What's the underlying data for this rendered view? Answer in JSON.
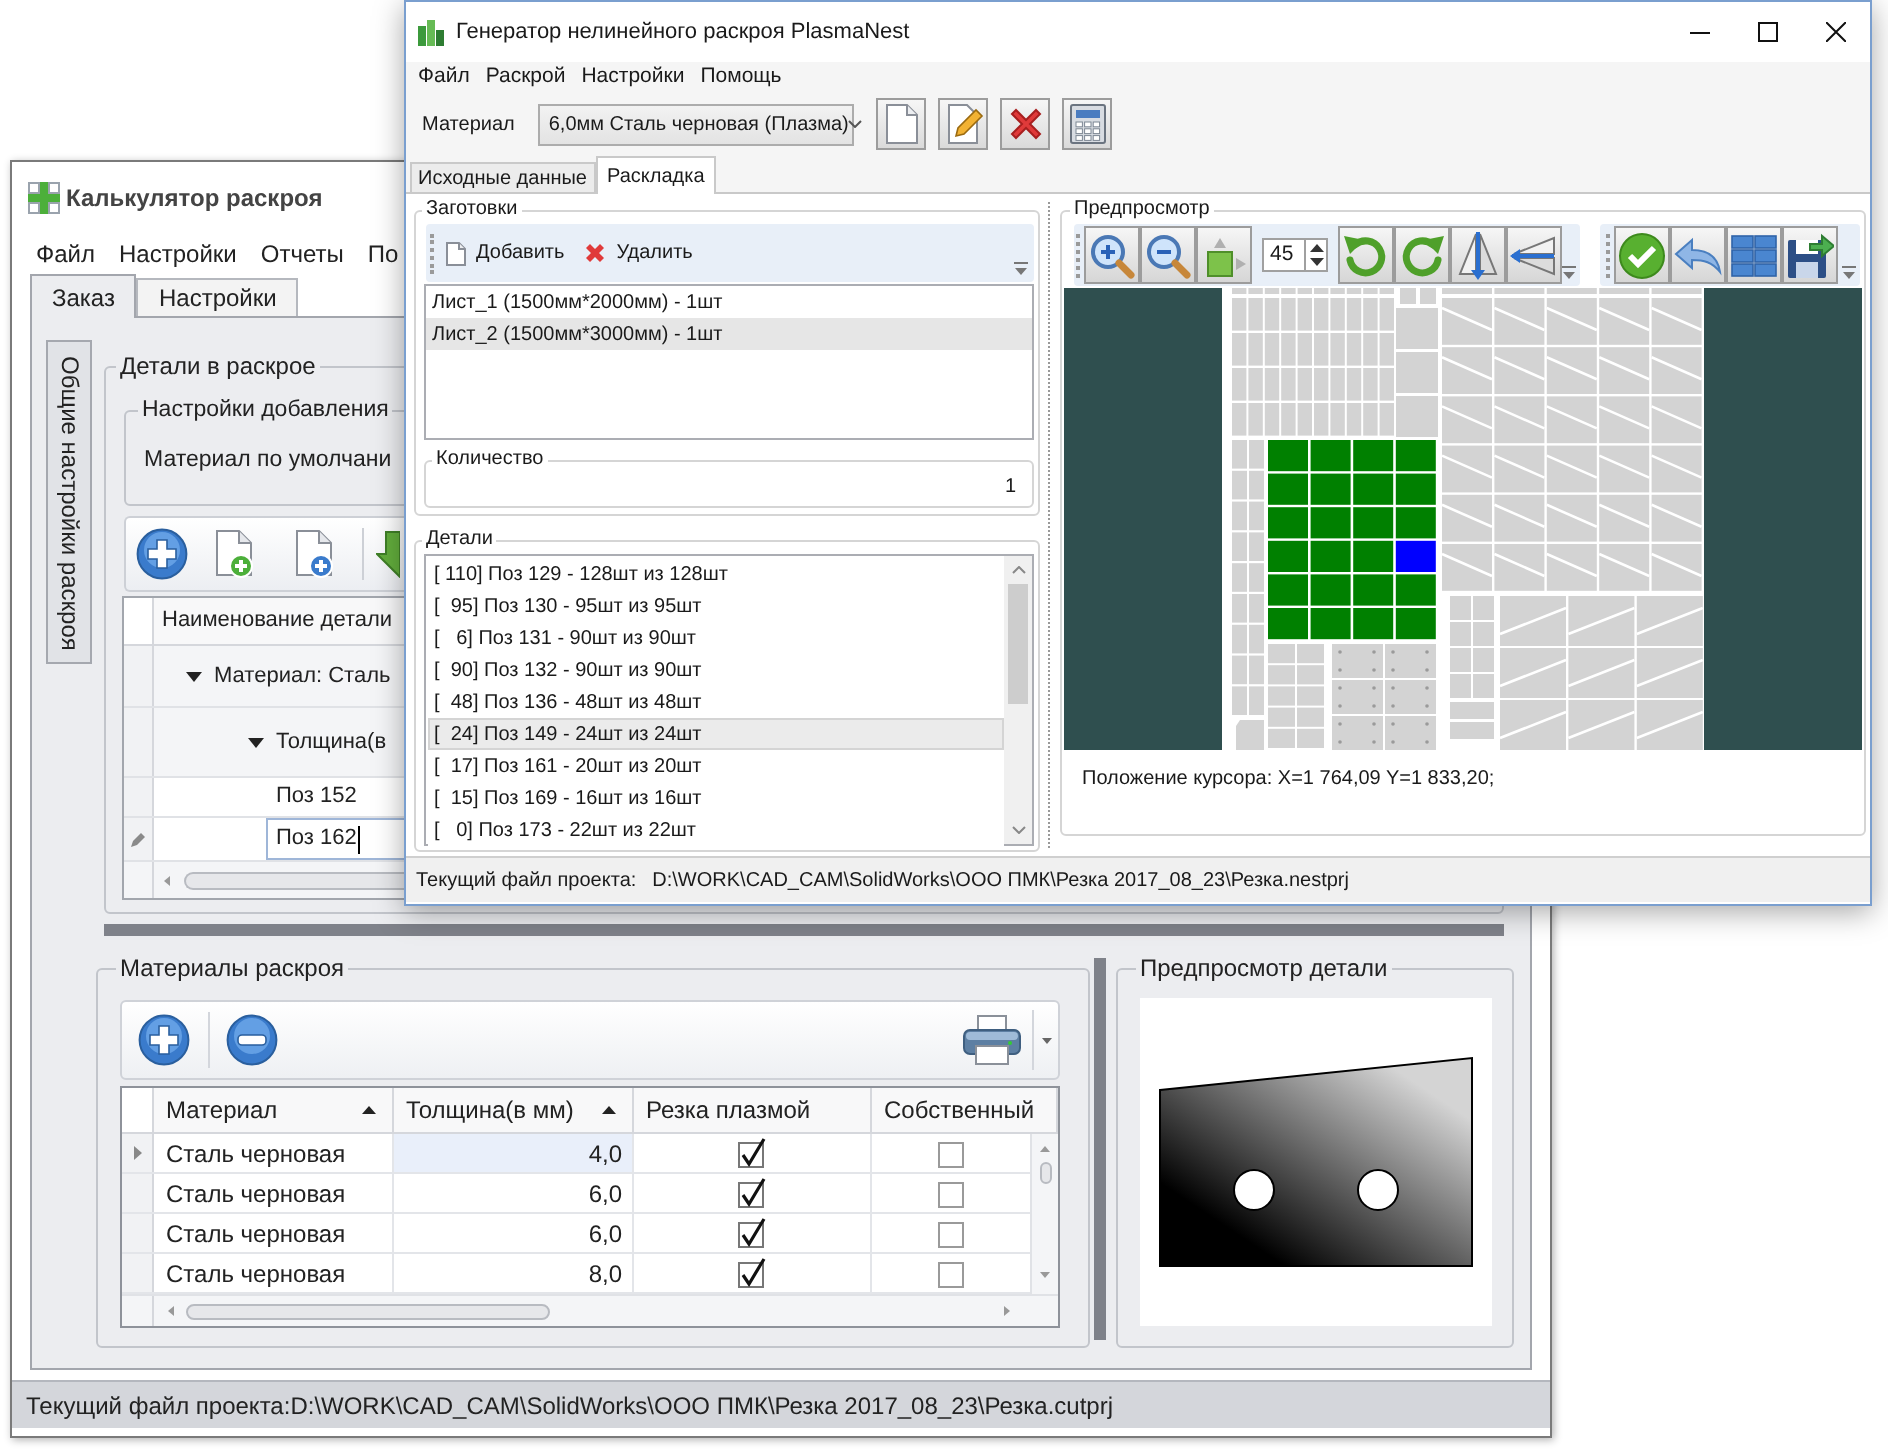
{
  "back_window": {
    "title": "Калькулятор раскроя",
    "menu": [
      "Файл",
      "Настройки",
      "Отчеты",
      "По"
    ],
    "tabs": [
      {
        "label": "Заказ",
        "selected": true
      },
      {
        "label": "Настройки",
        "selected": false
      }
    ],
    "side_tab": "Общие настройки раскроя",
    "parts_group": {
      "title": "Детали в раскрое",
      "settings_title": "Настройки добавления",
      "default_material_label": "Материал по умолчани",
      "grid": {
        "column": "Наименование детали",
        "rows": [
          {
            "label": "Материал: Сталь",
            "expanded": true,
            "children": [
              {
                "label": "Толщина(в",
                "expanded": true,
                "children": [
                  {
                    "label": "Поз 152",
                    "editing": false
                  },
                  {
                    "label": "Поз 162",
                    "editing": true
                  }
                ]
              }
            ]
          }
        ]
      }
    },
    "materials_group": {
      "title": "Материалы раскроя",
      "columns": [
        {
          "label": "Материал",
          "sorted": true
        },
        {
          "label": "Толщина(в мм)",
          "sorted": true
        },
        {
          "label": "Резка плазмой",
          "sorted": false
        },
        {
          "label": "Собственный",
          "sorted": false
        }
      ],
      "rows": [
        {
          "material": "Сталь черновая",
          "thickness": "4,0",
          "plasma": true,
          "own": false,
          "selected": true
        },
        {
          "material": "Сталь черновая",
          "thickness": "6,0",
          "plasma": true,
          "own": false,
          "selected": false
        },
        {
          "material": "Сталь черновая",
          "thickness": "6,0",
          "plasma": true,
          "own": false,
          "selected": false
        },
        {
          "material": "Сталь черновая",
          "thickness": "8,0",
          "plasma": true,
          "own": false,
          "selected": false
        }
      ]
    },
    "part_preview": {
      "title": "Предпросмотр детали"
    },
    "status_bar": "Текущий файл проекта:D:\\WORK\\CAD_CAM\\SolidWorks\\ООО ПМК\\Резка 2017_08_23\\Резка.cutprj"
  },
  "front_window": {
    "title": "Генератор нелинейного раскроя PlasmaNest",
    "menu": [
      "Файл",
      "Раскрой",
      "Настройки",
      "Помощь"
    ],
    "material": {
      "label": "Материал",
      "value": "6,0мм Сталь черновая (Плазма)"
    },
    "tabs": [
      {
        "label": "Исходные данные",
        "selected": false
      },
      {
        "label": "Раскладка",
        "selected": true
      }
    ],
    "blanks": {
      "title": "Заготовки",
      "actions": [
        {
          "kind": "add",
          "label": "Добавить"
        },
        {
          "kind": "delete",
          "label": "Удалить"
        }
      ],
      "items": [
        {
          "label": "Лист_1 (1500мм*2000мм) - 1шт",
          "selected": false
        },
        {
          "label": "Лист_2 (1500мм*3000мм) - 1шт",
          "selected": true
        }
      ]
    },
    "quantity": {
      "label": "Количество",
      "value": "1"
    },
    "details": {
      "title": "Детали",
      "items": [
        {
          "label": "[ 110] Поз 129 - 128шт из 128шт",
          "selected": false
        },
        {
          "label": "[  95] Поз 130 - 95шт из 95шт",
          "selected": false
        },
        {
          "label": "[   6] Поз 131 - 90шт из 90шт",
          "selected": false
        },
        {
          "label": "[  90] Поз 132 - 90шт из 90шт",
          "selected": false
        },
        {
          "label": "[  48] Поз 136 - 48шт из 48шт",
          "selected": false
        },
        {
          "label": "[  24] Поз 149 - 24шт из 24шт",
          "selected": true
        },
        {
          "label": "[  17] Поз 161 - 20шт из 20шт",
          "selected": false
        },
        {
          "label": "[  15] Поз 169 - 16шт из 16шт",
          "selected": false
        },
        {
          "label": "[   0] Поз 173 - 22шт из 22шт",
          "selected": false
        }
      ]
    },
    "preview": {
      "title": "Предпросмотр",
      "angle": "45",
      "cursor_position": "Положение курсора: X=1 764,09 Y=1 833,20;"
    },
    "status_bar": {
      "label": "Текущий файл проекта:",
      "path": "D:\\WORK\\CAD_CAM\\SolidWorks\\ООО ПМК\\Резка 2017_08_23\\Резка.nestprj"
    }
  }
}
